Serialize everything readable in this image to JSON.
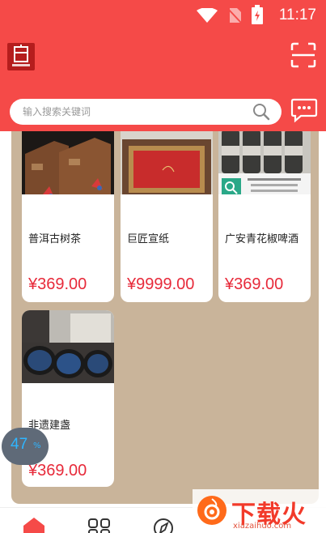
{
  "status_bar": {
    "time": "11:17"
  },
  "search": {
    "placeholder": "输入搜索关键词"
  },
  "products": [
    {
      "title": "普洱古树茶",
      "price": "¥369.00"
    },
    {
      "title": "巨匠宣纸",
      "price": "¥9999.00"
    },
    {
      "title": "广安青花椒啤酒",
      "price": "¥369.00"
    },
    {
      "title": "非遗建盏",
      "price": "¥369.00"
    }
  ],
  "progress": {
    "value": "47",
    "unit": "%"
  },
  "watermark": {
    "brand": "下载火",
    "url": "xiazaihuo.com"
  },
  "colors": {
    "header": "#f54a48",
    "content_bg": "#c9b49a",
    "price": "#e72a3a"
  }
}
